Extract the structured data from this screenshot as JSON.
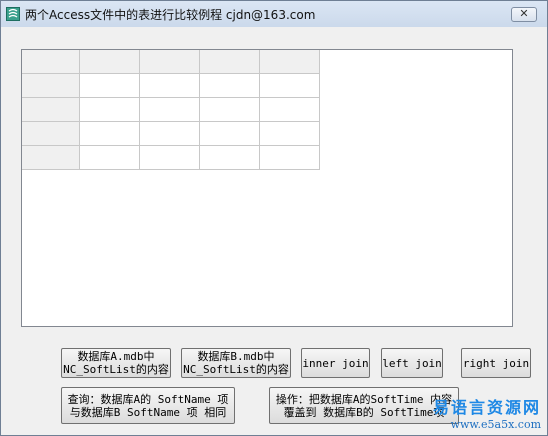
{
  "window": {
    "title": "两个Access文件中的表进行比较例程   cjdn@163.com",
    "close_label": "✕"
  },
  "grid": {
    "rows": 5,
    "cols": 5
  },
  "buttons": {
    "db_a": {
      "line1": "数据库A.mdb中",
      "line2": "NC_SoftList的内容"
    },
    "db_b": {
      "line1": "数据库B.mdb中",
      "line2": "NC_SoftList的内容"
    },
    "inner_join": "inner join",
    "left_join": "left join",
    "right_join": "right join",
    "query": {
      "line1": "查询：数据库A的 SoftName 项",
      "line2": "与数据库B SoftName 项 相同"
    },
    "operate": {
      "line1": "操作：把数据库A的SoftTime 内容",
      "line2": "覆盖到 数据库B的 SoftTime项"
    }
  },
  "watermark": {
    "top": "易语言资源网",
    "bottom": "www.e5a5x.com"
  },
  "colors": {
    "title_bar": "#d3dff0",
    "face": "#f0f0f0",
    "grid_line": "#c8c8c8",
    "watermark": "#1e88e5"
  }
}
